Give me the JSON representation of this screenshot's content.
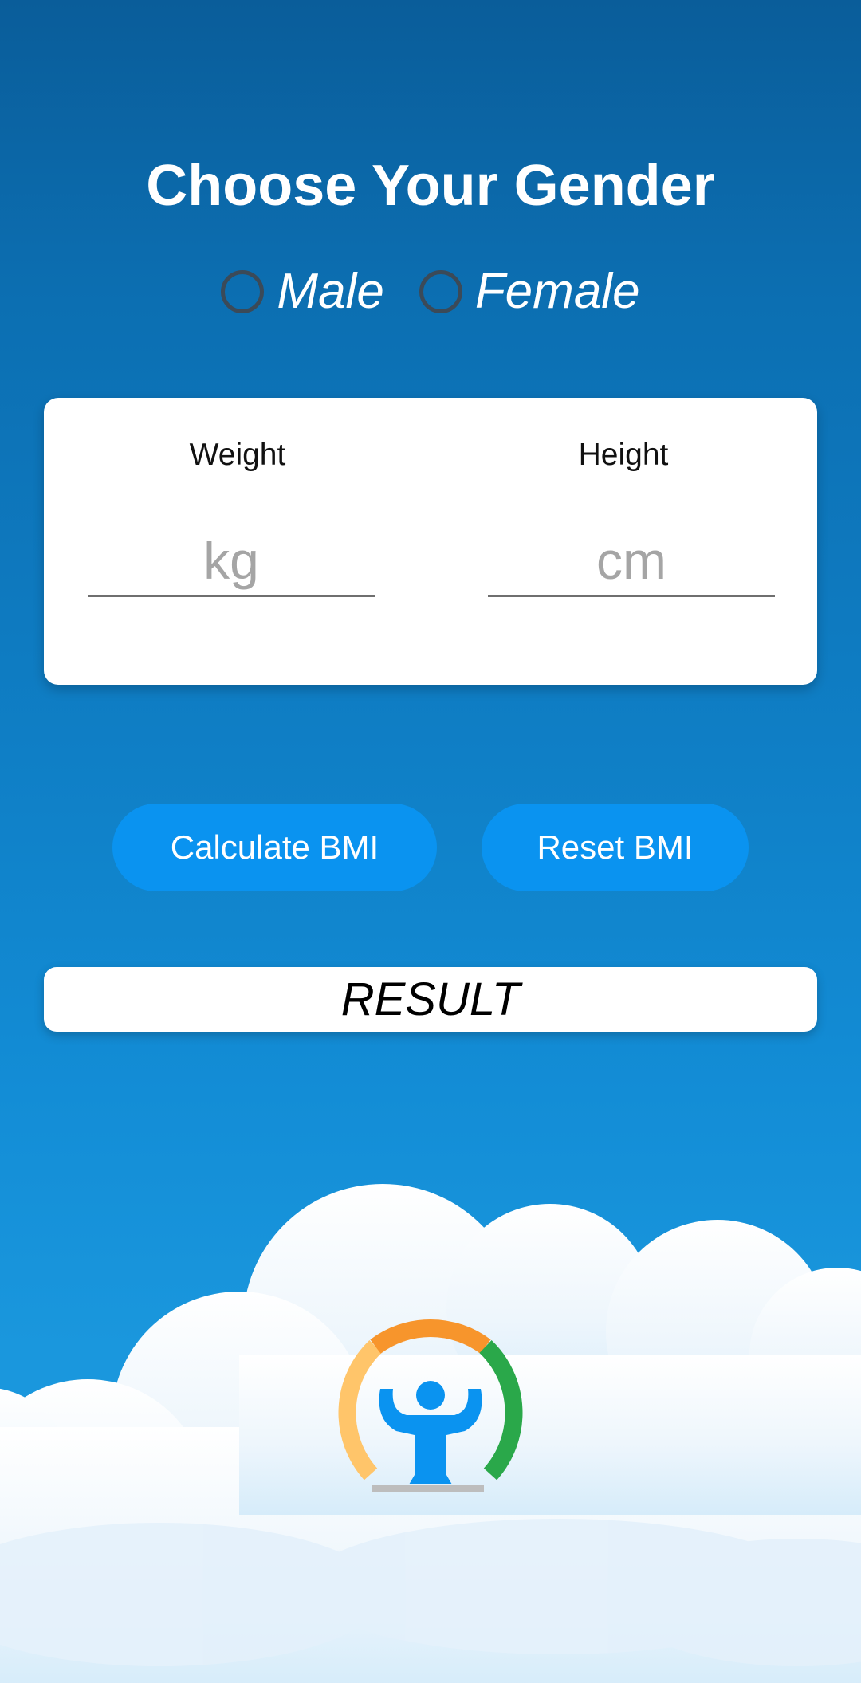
{
  "gender": {
    "title": "Choose Your Gender",
    "options": [
      {
        "label": "Male",
        "selected": false
      },
      {
        "label": "Female",
        "selected": false
      }
    ]
  },
  "inputs": {
    "weight_label": "Weight",
    "weight_placeholder": "kg",
    "height_label": "Height",
    "height_placeholder": "cm"
  },
  "buttons": {
    "calculate_label": "Calculate BMI",
    "reset_label": "Reset BMI"
  },
  "result": {
    "text": "RESULT"
  },
  "colors": {
    "primary_button": "#0a93f0",
    "background_blue": "#0f7fc6",
    "logo_orange": "#f7952c",
    "logo_yellow": "#ffc56a",
    "logo_green": "#2aa84a",
    "logo_figure": "#0a93f0"
  },
  "icons": {
    "logo": "bmi-gauge-person-icon"
  }
}
